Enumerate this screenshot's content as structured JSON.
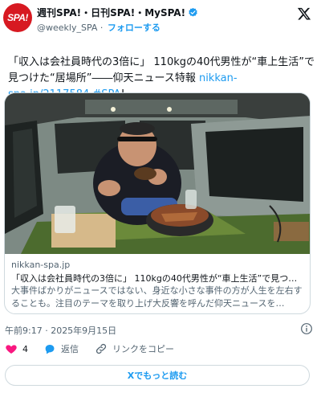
{
  "account": {
    "avatar_text": "SPA!",
    "display_name": "週刊SPA!・日刊SPA!・MySPA!",
    "handle": "@weekly_SPA",
    "separator": "·",
    "follow_label": "フォローする",
    "verified_color": "#1d9bf0"
  },
  "tweet": {
    "text_main": "「収入は会社員時代の3倍に」 110kgの40代男性が“車上生活”で見つけた“居場所”――仰天ニュース特報 ",
    "link_text": "nikkan-spa.jp/2117584",
    "hashtag": "#SPA",
    "suffix": "!"
  },
  "card": {
    "image_alt": "Man eating in a camper van",
    "domain": "nikkan-spa.jp",
    "title": "「収入は会社員時代の3倍に」 110kgの40代男性が“車上生活”で見つけ…",
    "description": "大事件ばかりがニュースではない、身近な小さな事件の方が人生を左右することも。注目のテーマを取り上げ大反響を呼んだ仰天ニュースを…"
  },
  "meta": {
    "timestamp": "午前9:17 · 2025年9月15日"
  },
  "actions": {
    "like_count": "4",
    "reply_label": "返信",
    "copy_label": "リンクをコピー",
    "like_color": "#f91880",
    "reply_color": "#1d9bf0"
  },
  "footer": {
    "read_more_label": "Xでもっと読む"
  },
  "icons": [
    "verified-icon",
    "x-logo-icon",
    "info-icon",
    "heart-icon",
    "reply-icon",
    "link-icon"
  ]
}
